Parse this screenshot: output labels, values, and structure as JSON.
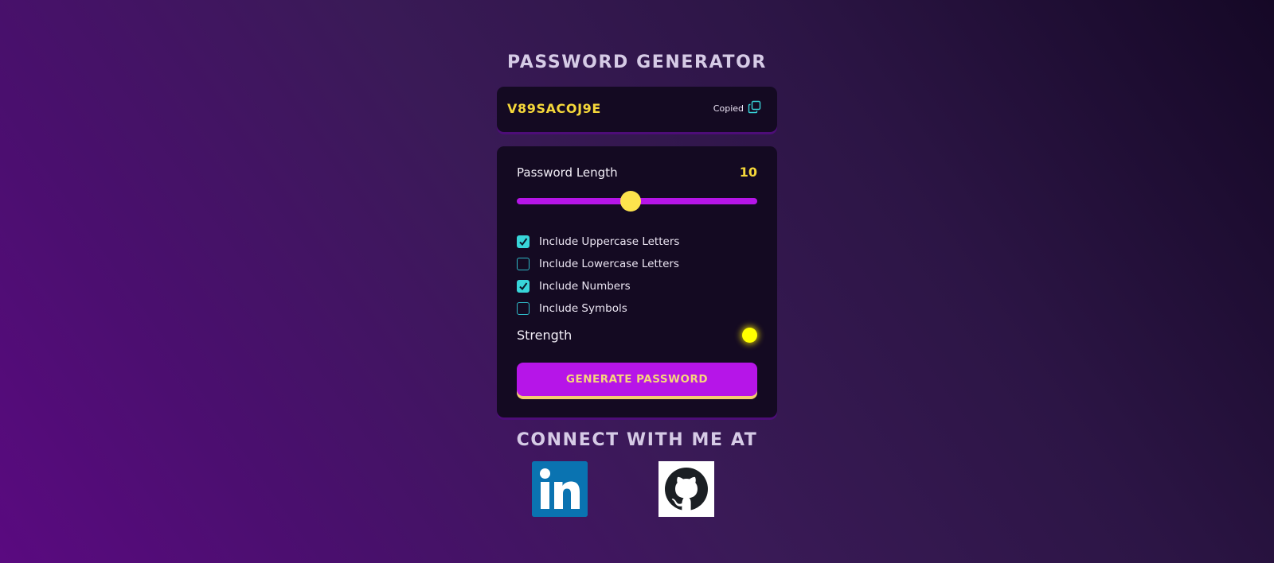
{
  "app": {
    "title": "PASSWORD GENERATOR"
  },
  "display": {
    "password": "V89SACOJ9E",
    "copied_label": "Copied",
    "copy_icon": "copy-icon"
  },
  "settings": {
    "length_label": "Password Length",
    "length_value": "10",
    "slider_fraction": 0.475,
    "options": [
      {
        "label": "Include Uppercase Letters",
        "checked": true
      },
      {
        "label": "Include Lowercase Letters",
        "checked": false
      },
      {
        "label": "Include Numbers",
        "checked": true
      },
      {
        "label": "Include Symbols",
        "checked": false
      }
    ],
    "strength_label": "Strength",
    "strength_color": "#ffff00",
    "generate_label": "GENERATE PASSWORD"
  },
  "footer": {
    "connect_label": "CONNECT WITH ME AT",
    "links": [
      {
        "icon": "linkedin-icon"
      },
      {
        "icon": "github-icon"
      }
    ]
  },
  "colors": {
    "accent": "#b615e8",
    "highlight": "#f5d73a",
    "check": "#38d5d9",
    "panel": "#140a22"
  }
}
